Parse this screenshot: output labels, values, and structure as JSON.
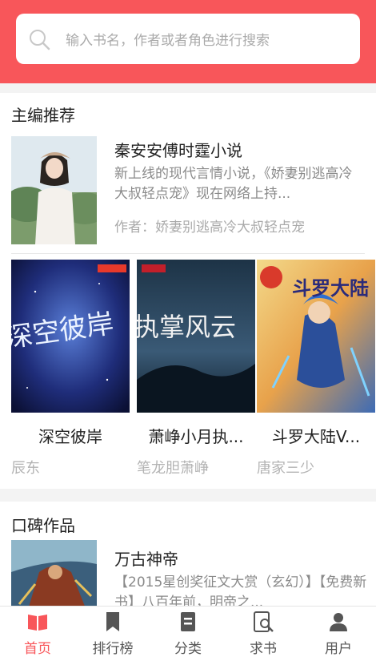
{
  "search": {
    "placeholder": "输入书名，作者或者角色进行搜索"
  },
  "editor_picks": {
    "section_title": "主编推荐",
    "featured": {
      "title": "秦安安傅时霆小说",
      "description": "新上线的现代言情小说，《娇妻别逃高冷大叔轻点宠》现在网络上持...",
      "author": "作者：娇妻别逃高冷大叔轻点宠"
    },
    "books": [
      {
        "title": "深空彼岸",
        "author": "辰东",
        "cover_text": "深空彼岸"
      },
      {
        "title": "萧峥小月执...",
        "author": "笔龙胆萧峥",
        "cover_text": "执掌风云"
      },
      {
        "title": "斗罗大陆V...",
        "author": "唐家三少",
        "cover_text": "斗罗大陆"
      }
    ]
  },
  "word_of_mouth": {
    "section_title": "口碑作品",
    "featured": {
      "title": "万古神帝",
      "description": "【2015星创奖征文大赏（玄幻）】【免费新书】八百年前，明帝之..."
    }
  },
  "tabbar": [
    {
      "label": "首页",
      "active": true
    },
    {
      "label": "排行榜",
      "active": false
    },
    {
      "label": "分类",
      "active": false
    },
    {
      "label": "求书",
      "active": false
    },
    {
      "label": "用户",
      "active": false
    }
  ],
  "colors": {
    "brand": "#f8565a",
    "tab_inactive": "#555555"
  }
}
